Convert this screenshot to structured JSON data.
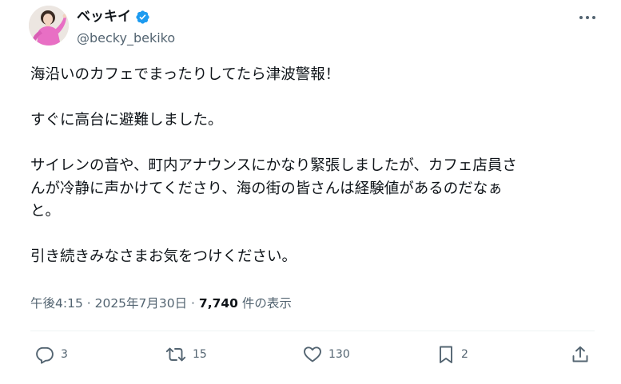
{
  "author": {
    "display_name": "ベッキイ",
    "handle": "@becky_bekiko",
    "verified_color": "#1d9bf0"
  },
  "icons": {
    "verified": "verified-badge-icon",
    "more": "more-dots-icon",
    "reply": "reply-bubble-icon",
    "retweet": "retweet-arrows-icon",
    "like": "heart-icon",
    "bookmark": "bookmark-icon",
    "share": "share-upload-icon"
  },
  "tweet": {
    "lines": [
      "海沿いのカフェでまったりしてたら津波警報！",
      "",
      "すぐに高台に避難しました。",
      "",
      "サイレンの音や、町内アナウンスにかなり緊張しましたが、カフェ店員さ",
      "んが冷静に声かけてくださり、海の街の皆さんは経験値があるのだなぁ",
      "と。",
      "",
      "引き続きみなさまお気をつけください。"
    ]
  },
  "meta": {
    "time": "午後4:15",
    "separator_1": " · ",
    "date": "2025年7月30日",
    "separator_2": " · ",
    "views_count": "7,740",
    "views_label": " 件の表示"
  },
  "actions": {
    "reply_count": "3",
    "retweet_count": "15",
    "like_count": "130",
    "bookmark_count": "2"
  },
  "colors": {
    "text_primary": "#0f1419",
    "text_secondary": "#536471",
    "divider": "#eff3f4",
    "avatar_outfit": "#e86fc4"
  }
}
